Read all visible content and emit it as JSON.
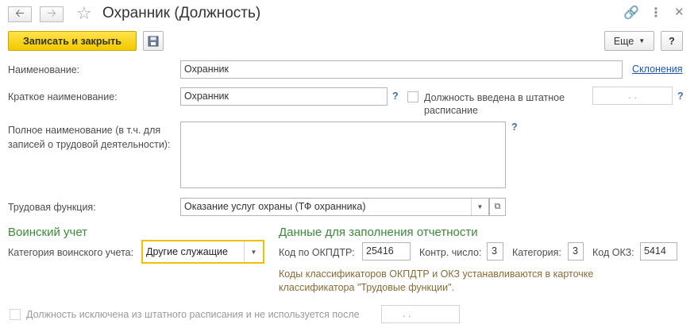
{
  "header": {
    "back_icon": "arrow-left-icon",
    "forward_icon": "arrow-right-icon",
    "title": "Охранник (Должность)",
    "star_icon": "star-icon",
    "link_icon": "link-icon",
    "more_icon": "vertical-dots-icon",
    "close_icon": "close-icon"
  },
  "toolbar": {
    "save_close_label": "Записать и закрыть",
    "more_label": "Еще",
    "help_label": "?"
  },
  "form": {
    "name_label": "Наименование:",
    "name_value": "Охранник",
    "declensions_link": "Склонения",
    "short_name_label": "Краткое наименование:",
    "short_name_value": "Охранник",
    "q": "?",
    "staff_checkbox_label_1": "Должность введена в штатное",
    "staff_checkbox_label_2": "расписание",
    "staff_date_value": ". .",
    "full_name_label_1": "Полное наименование (в т.ч. для",
    "full_name_label_2": "записей о трудовой деятельности):",
    "full_name_value": "",
    "labor_function_label": "Трудовая функция:",
    "labor_function_value": "Оказание услуг охраны (ТФ охранника)"
  },
  "military": {
    "section_title": "Воинский учет",
    "category_label": "Категория воинского учета:",
    "category_value": "Другие служащие"
  },
  "reporting": {
    "section_title": "Данные для заполнения отчетности",
    "okpdtr_label": "Код по ОКПДТР:",
    "okpdtr_value": "25416",
    "control_label": "Контр. число:",
    "control_value": "3",
    "category_label": "Категория:",
    "category_value": "3",
    "okz_label": "Код ОКЗ:",
    "okz_value": "5414",
    "hint_1": "Коды классификаторов ОКПДТР и ОКЗ устанавливаются в карточке",
    "hint_2": "классификатора \"Трудовые функции\"."
  },
  "footer": {
    "excluded_label": "Должность исключена из штатного расписания и не используется после",
    "excluded_date_value": ". ."
  }
}
